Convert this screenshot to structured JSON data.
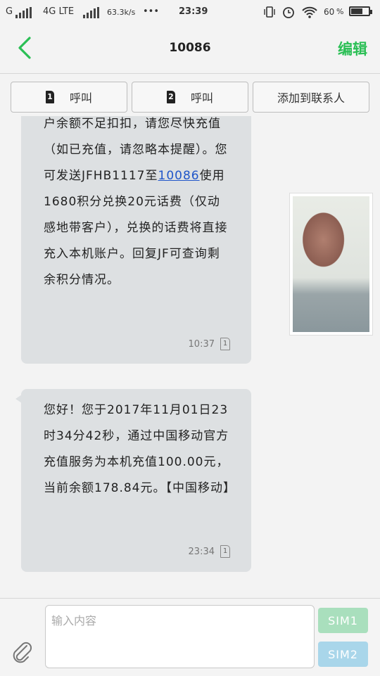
{
  "status_bar": {
    "carrier1": "G",
    "network": "4G LTE",
    "speed": "63.3k/s",
    "dots": "•••",
    "time": "23:39",
    "battery": "60",
    "battery_level": 0.6
  },
  "header": {
    "title": "10086",
    "edit_label": "编辑"
  },
  "actions": {
    "call1": {
      "sim": "1",
      "label": "呼叫"
    },
    "call2": {
      "sim": "2",
      "label": "呼叫"
    },
    "add_contact": "添加到联系人"
  },
  "messages": [
    {
      "text_before": "户余额不足扣扣，请您尽快充值（如已充值，请忽略本提醒）。您可发送JFHB1117至",
      "link": "10086",
      "text_after": "使用1680积分兑换20元话费（仅动感地带客户），兑换的话费将直接充入本机账户。回复JF可查询剩余积分情况。",
      "time": "10:37",
      "sim": "1"
    },
    {
      "text": "您好！您于2017年11月01日23时34分42秒，通过中国移动官方充值服务为本机充值100.00元，当前余额178.84元。【中国移动】",
      "time": "23:34",
      "sim": "1"
    }
  ],
  "compose": {
    "placeholder": "输入内容",
    "sim1_label": "SIM1",
    "sim2_label": "SIM2"
  },
  "colors": {
    "accent": "#2bbf55",
    "bubble": "#dde0e2",
    "sim1": "#a9dfbd",
    "sim2": "#a9d6ea"
  },
  "icons": [
    "back-arrow-icon",
    "signal-icon",
    "wifi-icon",
    "alarm-icon",
    "vibrate-icon",
    "battery-icon",
    "paperclip-icon"
  ]
}
